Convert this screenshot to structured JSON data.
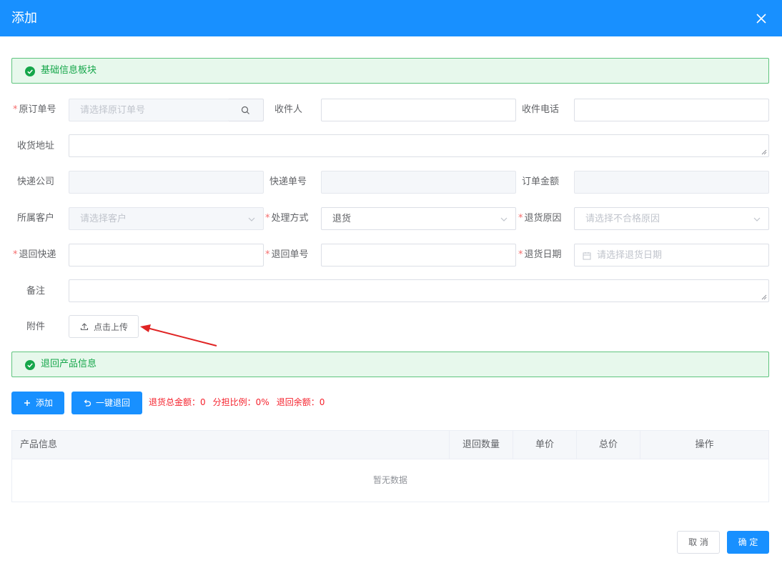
{
  "dialog": {
    "title": "添加"
  },
  "section1": {
    "label": "基础信息板块"
  },
  "section2": {
    "label": "退回产品信息"
  },
  "form": {
    "orig_order": {
      "label": "原订单号",
      "placeholder": "请选择原订单号"
    },
    "recipient": {
      "label": "收件人",
      "value": ""
    },
    "phone": {
      "label": "收件电话",
      "value": ""
    },
    "address": {
      "label": "收货地址",
      "value": ""
    },
    "courier": {
      "label": "快递公司",
      "value": ""
    },
    "tracking": {
      "label": "快递单号",
      "value": ""
    },
    "amount": {
      "label": "订单金额",
      "value": ""
    },
    "customer": {
      "label": "所属客户",
      "placeholder": "请选择客户"
    },
    "method": {
      "label": "处理方式",
      "value": "退货"
    },
    "reason": {
      "label": "退货原因",
      "placeholder": "请选择不合格原因"
    },
    "return_courier": {
      "label": "退回快递",
      "value": ""
    },
    "return_no": {
      "label": "退回单号",
      "value": ""
    },
    "return_date": {
      "label": "退货日期",
      "placeholder": "请选择退货日期"
    },
    "remark": {
      "label": "备注",
      "value": ""
    },
    "attachment": {
      "label": "附件",
      "upload_label": "点击上传"
    },
    "required_mark": "*"
  },
  "actions": {
    "add_label": "添加",
    "return_all_label": "一键退回"
  },
  "stats": {
    "total": "退货总金额：0",
    "ratio": "分担比例：0%",
    "balance": "退回余额：0"
  },
  "table": {
    "columns": [
      "产品信息",
      "退回数量",
      "单价",
      "总价",
      "操作"
    ],
    "empty_text": "暂无数据"
  },
  "footer": {
    "cancel_label": "取 消",
    "ok_label": "确 定"
  },
  "colors": {
    "primary": "#1890ff",
    "success_bg": "#e7f8ec",
    "success_text": "#15a64a",
    "required": "#f56c6c",
    "stats": "#f5222d",
    "annotation_arrow": "#e02424"
  },
  "icons": [
    "close-icon",
    "check-circle-icon",
    "search-icon",
    "chevron-down-icon",
    "calendar-icon",
    "upload-icon",
    "plus-icon",
    "undo-icon",
    "arrow-annotation"
  ]
}
